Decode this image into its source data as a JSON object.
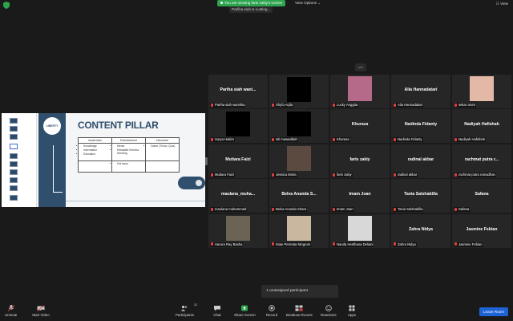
{
  "topbar": {
    "share_notice": "You are viewing faris zakiy's screen",
    "view_options": "View Options",
    "view_button": "View",
    "speaker_label": "Parliha siah & Lusting..."
  },
  "slide": {
    "logo_text": "LIBERTY",
    "title": "CONTENT PILLAR",
    "headers": [
      "Awareness",
      "Entertainment",
      "Interactive"
    ],
    "awareness_items": [
      "Knowledge",
      "Information",
      "Education"
    ],
    "entertainment_items": [
      "Meme",
      "Relatable Kemitra Seruting"
    ],
    "interactive_items": [
      "Game (Trivia / Quiz)"
    ],
    "entertainment_row2": "Hot issue"
  },
  "gallery": {
    "tiles": [
      {
        "name": "Pariha siah wani...",
        "label": "Pariha siah wanirika",
        "kind": "name"
      },
      {
        "name": "",
        "label": "Shyfa Aqila",
        "kind": "black"
      },
      {
        "name": "",
        "label": "Lucky Anggita",
        "kind": "photo",
        "color": "#b56a8a"
      },
      {
        "name": "Alia Hannadatari",
        "label": "Alia Hannadatari",
        "kind": "name"
      },
      {
        "name": "",
        "label": "sekar arum",
        "kind": "photo",
        "color": "#e3b8a6"
      },
      {
        "name": "",
        "label": "Surya Hakim",
        "kind": "black"
      },
      {
        "name": "",
        "label": "siti mawaddah",
        "kind": "black"
      },
      {
        "name": "Khuraza",
        "label": "Khuraza",
        "kind": "name"
      },
      {
        "name": "Nadinda Fidanty",
        "label": "Nadinda Fidanty",
        "kind": "name"
      },
      {
        "name": "Nadiyah Hafishah",
        "label": "Nadiyah Hafishah",
        "kind": "name"
      },
      {
        "name": "Mutiara Faizi",
        "label": "Mutiara Faizi",
        "kind": "name"
      },
      {
        "name": "",
        "label": "Jessica Moria",
        "kind": "photo",
        "color": "#5a4a40"
      },
      {
        "name": "faris zakiy",
        "label": "faris zakiy",
        "kind": "name"
      },
      {
        "name": "radinal akbar",
        "label": "radinal akbar",
        "kind": "name"
      },
      {
        "name": "rachmat putra r...",
        "label": "rachmat putra ramadhan",
        "kind": "name"
      },
      {
        "name": "maulana_muha...",
        "label": "maulana muhammad",
        "kind": "name"
      },
      {
        "name": "Belva Ananda S...",
        "label": "Belva Ananda Shara",
        "kind": "name"
      },
      {
        "name": "Imam Joan",
        "label": "Imam Joan",
        "kind": "name"
      },
      {
        "name": "Tania Salshabilla",
        "label": "Tania Salshabilla",
        "kind": "name"
      },
      {
        "name": "Safana",
        "label": "Safana",
        "kind": "name"
      },
      {
        "name": "",
        "label": "Harura Ray Basha",
        "kind": "photo",
        "color": "#6b6455"
      },
      {
        "name": "",
        "label": "Intan Permata Ningrum",
        "kind": "photo",
        "color": "#c9b7a0"
      },
      {
        "name": "",
        "label": "Nanda Hesthana Deliani",
        "kind": "photo",
        "color": "#d8d8d8"
      },
      {
        "name": "Zahra Nidya",
        "label": "Zahra Nidya",
        "kind": "name"
      },
      {
        "name": "Jasmine Febian",
        "label": "Jasmine Febian",
        "kind": "name"
      }
    ],
    "unassigned": "1 unassigned participant"
  },
  "toolbar": {
    "unmute": "Unmute",
    "start_video": "Start Video",
    "participants": "Participants",
    "participants_count": "32",
    "chat": "Chat",
    "share_screen": "Share Screen",
    "record": "Record",
    "breakout_rooms": "Breakout Rooms",
    "reactions": "Reactions",
    "apps": "Apps",
    "leave_room": "Leave Room"
  },
  "colors": {
    "accent_green": "#2da44e",
    "leave_blue": "#1e63d6",
    "slide_navy": "#2f4f6d",
    "muted_red": "#e0413d"
  }
}
